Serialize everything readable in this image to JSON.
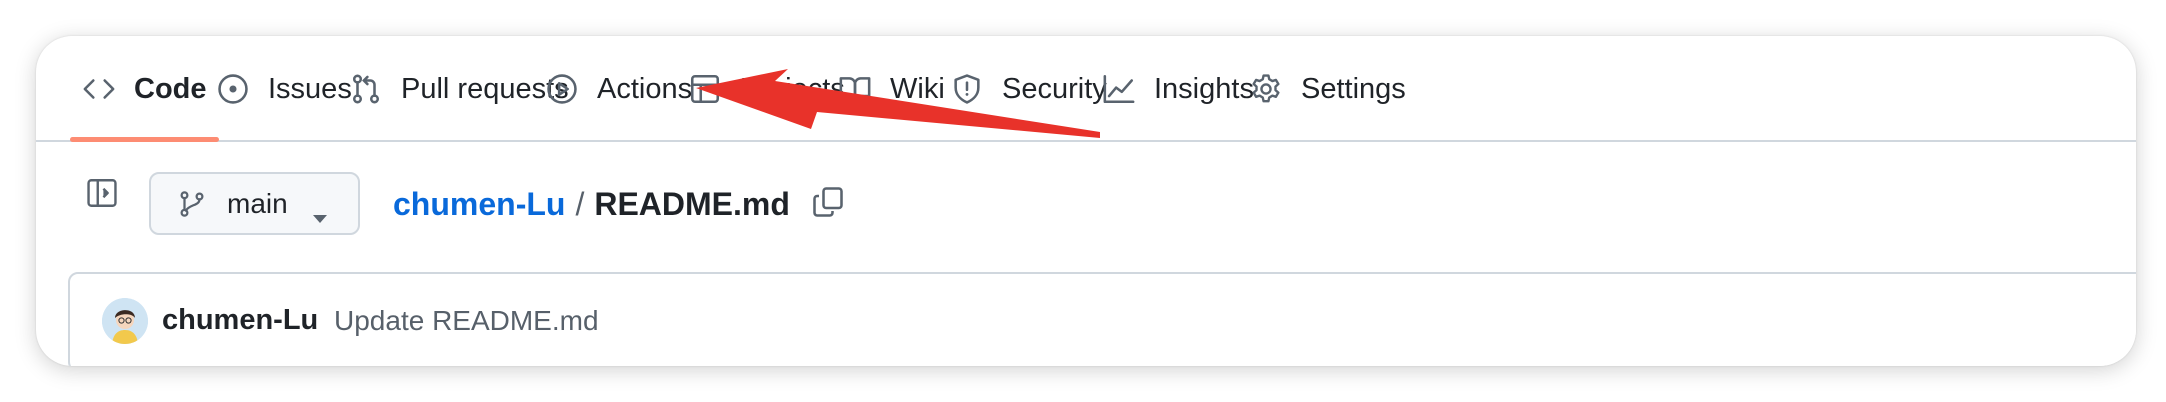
{
  "nav": {
    "tabs": [
      {
        "label": "Code",
        "icon": "code-icon",
        "active": true
      },
      {
        "label": "Issues",
        "icon": "issue-opened-icon"
      },
      {
        "label": "Pull requests",
        "icon": "git-pull-request-icon"
      },
      {
        "label": "Actions",
        "icon": "play-icon"
      },
      {
        "label": "Projects",
        "icon": "table-icon"
      },
      {
        "label": "Wiki",
        "icon": "book-icon"
      },
      {
        "label": "Security",
        "icon": "shield-icon"
      },
      {
        "label": "Insights",
        "icon": "graph-icon"
      },
      {
        "label": "Settings",
        "icon": "gear-icon"
      }
    ]
  },
  "file_header": {
    "branch": "main",
    "repo": "chumen-Lu",
    "separator": "/",
    "file": "README.md"
  },
  "commit": {
    "author": "chumen-Lu",
    "message": "Update README.md"
  },
  "colors": {
    "link": "#0969da",
    "active_underline": "#fd8c73",
    "annotation_arrow": "#e8322a"
  }
}
